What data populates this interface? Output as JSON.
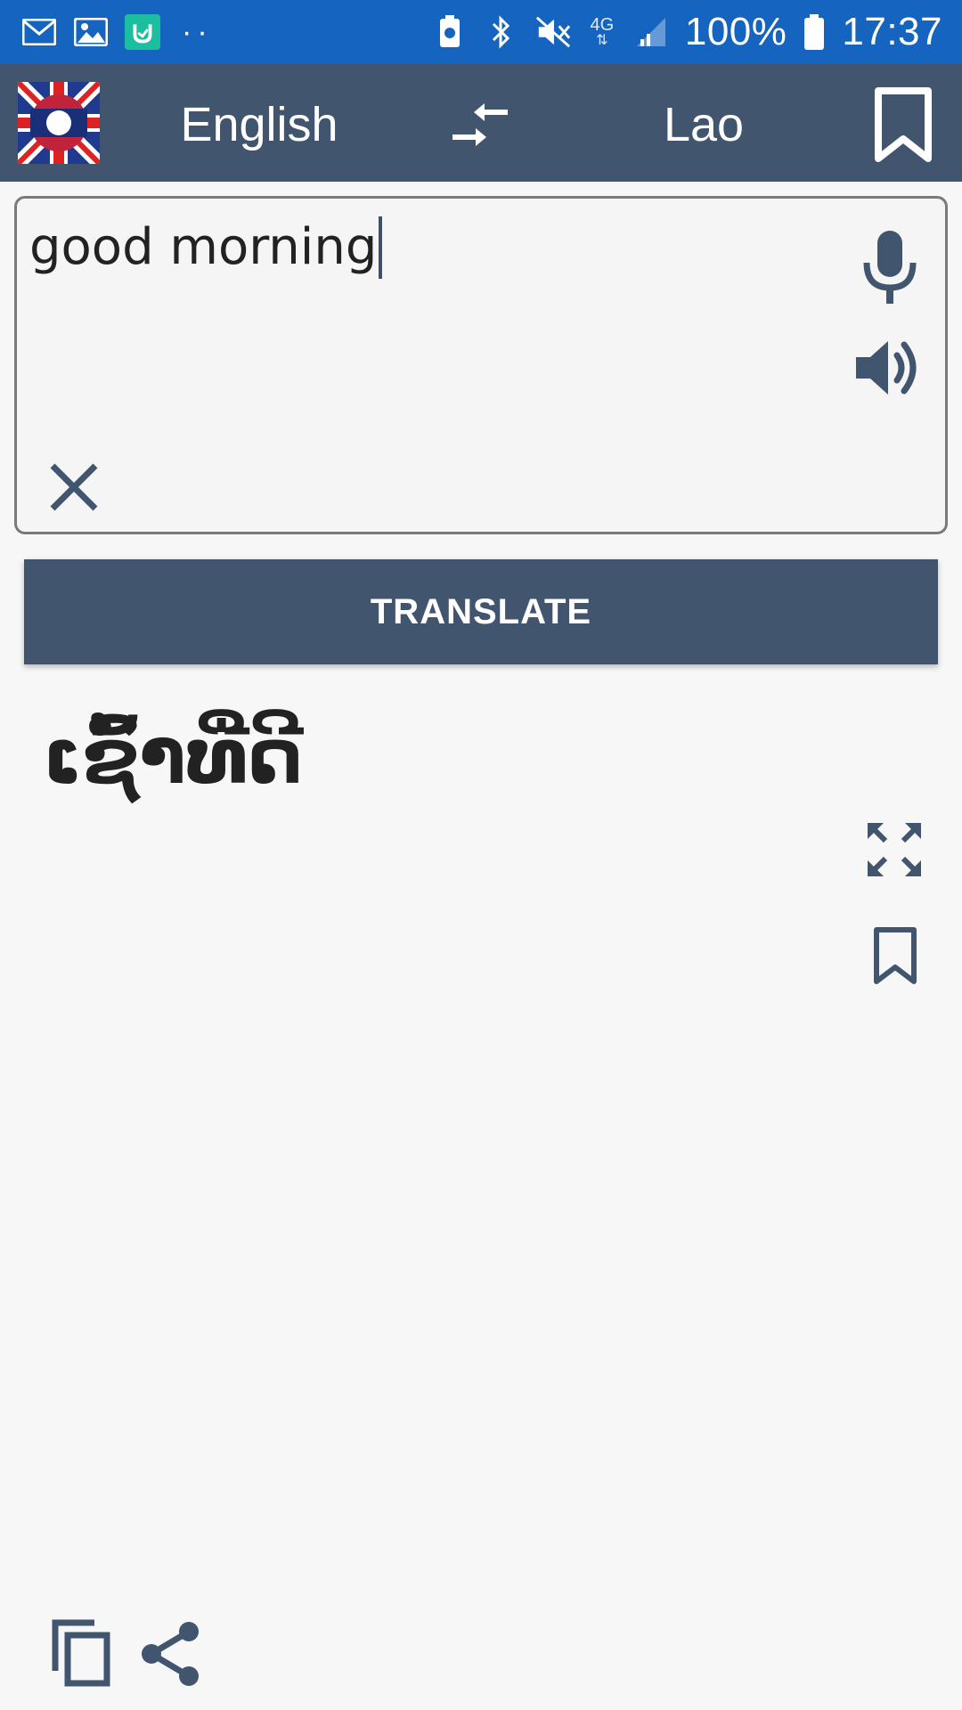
{
  "status_bar": {
    "battery_percent": "100%",
    "time": "17:37",
    "network_label": "4G",
    "dots": "··",
    "icons": [
      "gmail-icon",
      "gallery-icon",
      "mi-app-icon",
      "battery-saver-icon",
      "bluetooth-icon",
      "mute-icon",
      "signal-icon",
      "battery-icon"
    ],
    "bar_color": "#1565c0"
  },
  "app_bar": {
    "source_language": "English",
    "target_language": "Lao",
    "icons": [
      "flag-icon",
      "swap-languages-icon",
      "bookmark-icon"
    ],
    "bar_color": "#41566e"
  },
  "input": {
    "value": "good morning",
    "icons": [
      "microphone-icon",
      "speaker-icon",
      "clear-icon"
    ]
  },
  "translate_button": {
    "label": "TRANSLATE"
  },
  "output": {
    "translation": "ເຊົ້າທີ່ດີ",
    "icons": [
      "fullscreen-icon",
      "bookmark-icon",
      "copy-icon",
      "share-icon"
    ]
  },
  "colors": {
    "accent": "#41566e",
    "background": "#f7f7f7"
  }
}
